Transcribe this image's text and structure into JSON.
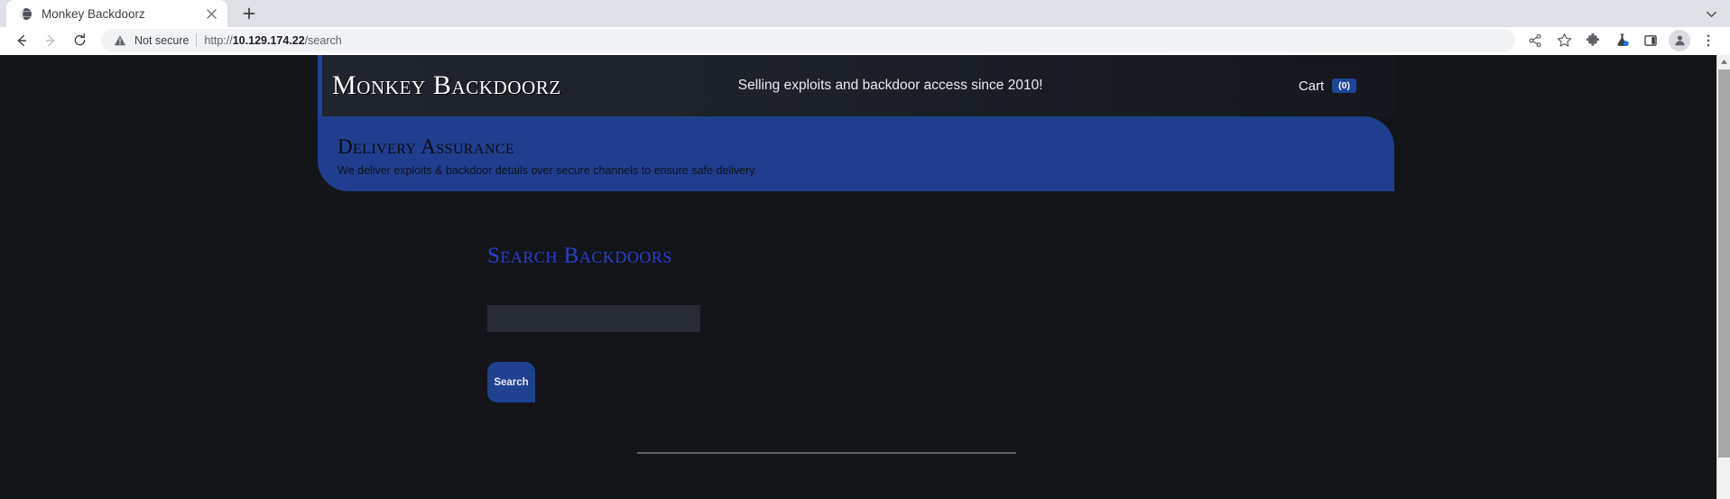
{
  "browser": {
    "tab": {
      "title": "Monkey Backdoorz",
      "favicon_icon": "globe-icon",
      "close_icon": "close-icon"
    },
    "new_tab_icon": "plus-icon",
    "window_chevron_icon": "chevron-down-icon",
    "nav": {
      "back_icon": "arrow-back-icon",
      "forward_icon": "arrow-forward-icon",
      "reload_icon": "reload-icon"
    },
    "omnibox": {
      "warning_icon": "warning-triangle-icon",
      "security_label": "Not secure",
      "url_scheme": "http://",
      "url_host": "10.129.174.22",
      "url_path": "/search",
      "url_full": "http://10.129.174.22/search"
    },
    "toolbar_icons": [
      "share-icon",
      "star-bookmark-icon",
      "puzzle-extensions-icon",
      "flask-lab-icon",
      "side-panel-icon",
      "profile-avatar-icon",
      "three-dot-menu-icon"
    ],
    "scrollbar": {
      "up_arrow_icon": "scroll-up-arrow-icon"
    }
  },
  "site": {
    "header": {
      "brand": "Monkey Backdoorz",
      "tagline": "Selling exploits and backdoor access since 2010!",
      "cart_label": "Cart",
      "cart_count": "(0)"
    },
    "assurance": {
      "title": "Delivery Assurance",
      "subtitle": "We deliver exploits & backdoor details over secure channels to ensure safe delivery."
    },
    "search": {
      "heading": "Search Backdoors",
      "input_value": "",
      "input_placeholder": "",
      "button_label": "Search"
    }
  },
  "colors": {
    "page_background": "#131519",
    "header_background": "#20242e",
    "accent_blue": "#1f4190",
    "banner_blue": "#1f3f8e",
    "heading_blue": "#2b3fd4",
    "input_background": "#272b36",
    "divider": "#5d6068"
  }
}
